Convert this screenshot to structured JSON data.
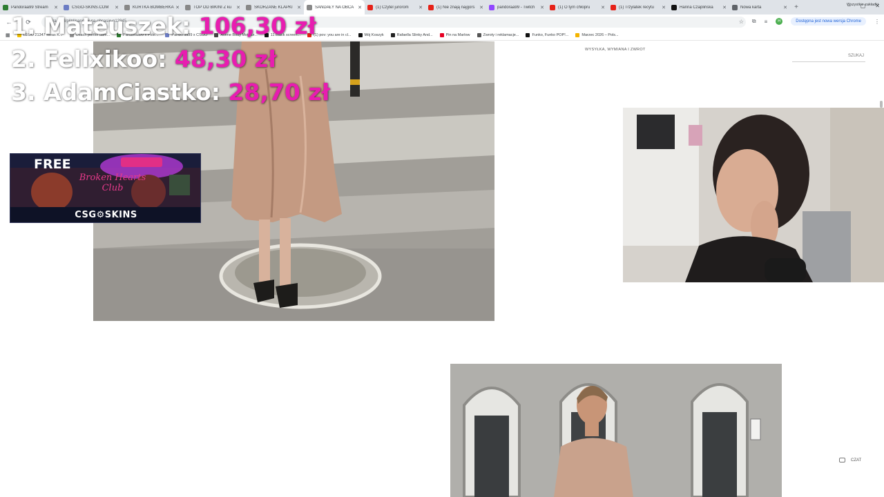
{
  "browser": {
    "tabs": [
      {
        "title": "Pandoraa99 Stream",
        "color": "#2e7d32",
        "active": false
      },
      {
        "title": "CSGO-SKINS.COM",
        "color": "#6b7cc4",
        "active": false
      },
      {
        "title": "KURTKA BOMBERKA",
        "color": "#888888",
        "active": false
      },
      {
        "title": "TOP OD BIKINI Z ku",
        "color": "#888888",
        "active": false
      },
      {
        "title": "SKÓRZANE KLAPKI",
        "color": "#888888",
        "active": false
      },
      {
        "title": "SANDAŁY NA OBCA",
        "color": "#888888",
        "active": true
      },
      {
        "title": "(1) Czytel jurorom",
        "color": "#e62117",
        "active": false
      },
      {
        "title": "(1) Nie znają najgors",
        "color": "#e62117",
        "active": false
      },
      {
        "title": "pandoraa99 - Twitch",
        "color": "#9146ff",
        "active": false
      },
      {
        "title": "(1) O tym chłopru",
        "color": "#e62117",
        "active": false
      },
      {
        "title": "(1) Trzylatek recytu",
        "color": "#e62117",
        "active": false
      },
      {
        "title": "Hanna Czaplińska",
        "color": "#111111",
        "active": false
      },
      {
        "title": "Nowa karta",
        "color": "#5f6368",
        "active": false
      }
    ],
    "new_tab": "+",
    "window_controls": {
      "minimize": "–",
      "maximize": "▢",
      "close": "✕"
    },
    "nav": {
      "back": "←",
      "forward": "→",
      "reload": "⟳"
    },
    "url": "zara.com/pl/pl/sandaly-na-obcasie-p12345",
    "update_text": "Dostępna jest nowa wersja Chrome",
    "profile_letter": "H",
    "bookmarks": [
      {
        "label": "LEGO 21347 Ideas K...",
        "color": "#f5c400"
      },
      {
        "label": "Coach portfel dam...",
        "color": "#999999"
      },
      {
        "label": "Pandoraa99 x Pole...",
        "color": "#2e7d32"
      },
      {
        "label": "Pandoraa99 x CSGO",
        "color": "#6b7cc4"
      },
      {
        "label": "Avene Body Moistur...",
        "color": "#444444"
      },
      {
        "label": "11 Black screen...",
        "color": "#111111"
      },
      {
        "label": "(1) pov: you are in cl...",
        "color": "#e62117"
      },
      {
        "label": "Mój Koszyk",
        "color": "#111111"
      },
      {
        "label": "Rafaella Slinky And...",
        "color": "#222222"
      },
      {
        "label": "Pin na Marlow",
        "color": "#e60023"
      },
      {
        "label": "Zwroty i reklamacje...",
        "color": "#555555"
      },
      {
        "label": "Funko, Funko POP!...",
        "color": "#111111"
      },
      {
        "label": "Marzec 2026 – Pols...",
        "color": "#f4b400"
      }
    ],
    "bookmarks_right": "Wszystkie zakładki"
  },
  "page": {
    "nav_text": "WYSYŁKA, WYMIANA I ZWROT",
    "search_label": "SZUKAJ",
    "chat_label": "CZAT"
  },
  "overlay": {
    "leaderboard": [
      {
        "rank_name": "1. Mateuszek:",
        "amount": "106,30 zł"
      },
      {
        "rank_name": "2. Felixikoo:",
        "amount": "48,30 zł"
      },
      {
        "rank_name": "3. AdamCiastko:",
        "amount": "28,70 zł"
      }
    ],
    "ad": {
      "free": "FREE",
      "script_text": "Broken Hearts Club",
      "brand": "CSG⚙SKINS"
    }
  }
}
